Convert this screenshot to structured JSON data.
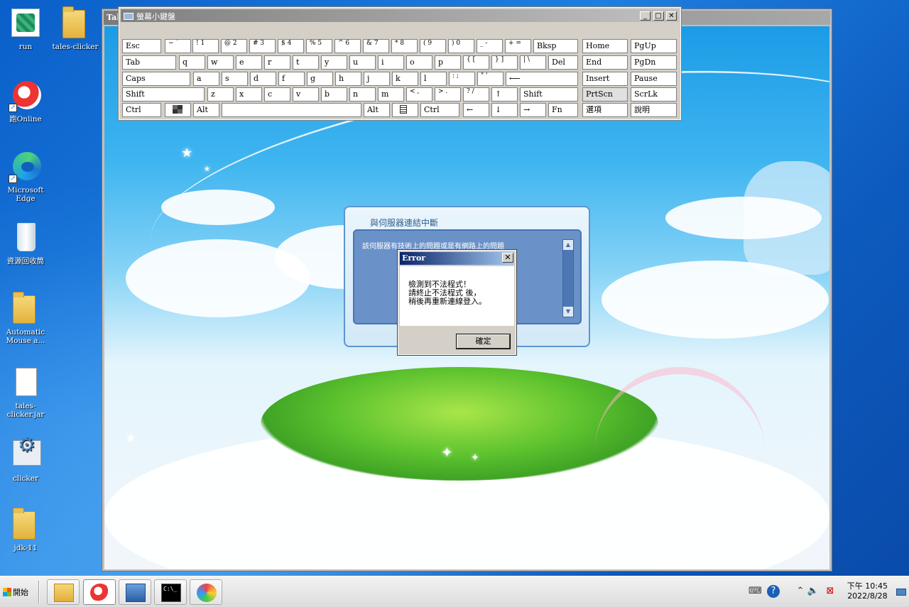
{
  "desktop": {
    "icons": [
      {
        "label": "run"
      },
      {
        "label": "tales-clicker"
      },
      {
        "label": "跑Online"
      },
      {
        "label": "Microsoft Edge"
      },
      {
        "label": "資源回收筒"
      },
      {
        "label": "Automatic Mouse a..."
      },
      {
        "label": "tales-clicker.jar"
      },
      {
        "label": "clicker"
      },
      {
        "label": "jdk-11"
      }
    ]
  },
  "game_window": {
    "title": "Tal",
    "server_panel": {
      "title": "與伺服器連結中斷",
      "message": "該伺服器有技術上的問題或是有網路上的問題"
    }
  },
  "error_dialog": {
    "title": "Error",
    "close_glyph": "✕",
    "lines": [
      "檢測到不法程式！",
      "請終止不法程式 後，",
      "稍後再重新連線登入。"
    ],
    "ok_label": "確定"
  },
  "osk": {
    "title": "螢幕小鍵盤",
    "buttons": {
      "minimize": "_",
      "maximize": "□",
      "close": "✕"
    },
    "rows": [
      [
        "Esc",
        "~ `",
        "! 1",
        "@ 2",
        "# 3",
        "$ 4",
        "% 5",
        "^ 6",
        "& 7",
        "* 8",
        "( 9",
        ") 0",
        "_ -",
        "+ =",
        "Bksp",
        "Home",
        "PgUp"
      ],
      [
        "Tab",
        "q",
        "w",
        "e",
        "r",
        "t",
        "y",
        "u",
        "i",
        "o",
        "p",
        "{ [",
        "} ]",
        "| \\",
        "Del",
        "End",
        "PgDn"
      ],
      [
        "Caps",
        "a",
        "s",
        "d",
        "f",
        "g",
        "h",
        "j",
        "k",
        "l",
        ": ;",
        "\" '",
        "⟵",
        "Insert",
        "Pause"
      ],
      [
        "Shift",
        "z",
        "x",
        "c",
        "v",
        "b",
        "n",
        "m",
        "< ,",
        "> .",
        "? /",
        "↑",
        "Shift",
        "PrtScn",
        "ScrLk"
      ],
      [
        "Ctrl",
        "win",
        "Alt",
        "",
        "Alt",
        "menu",
        "Ctrl",
        "←",
        "↓",
        "→",
        "Fn",
        "選項",
        "說明"
      ]
    ]
  },
  "taskbar": {
    "start_label": "開始",
    "apps": [
      {
        "icon": "file-explorer-icon"
      },
      {
        "icon": "pao-online-icon"
      },
      {
        "icon": "computer-management-icon"
      },
      {
        "icon": "command-prompt-icon"
      },
      {
        "icon": "paint-icon"
      }
    ],
    "clock_time": "下午 10:45",
    "clock_date": "2022/8/28"
  }
}
